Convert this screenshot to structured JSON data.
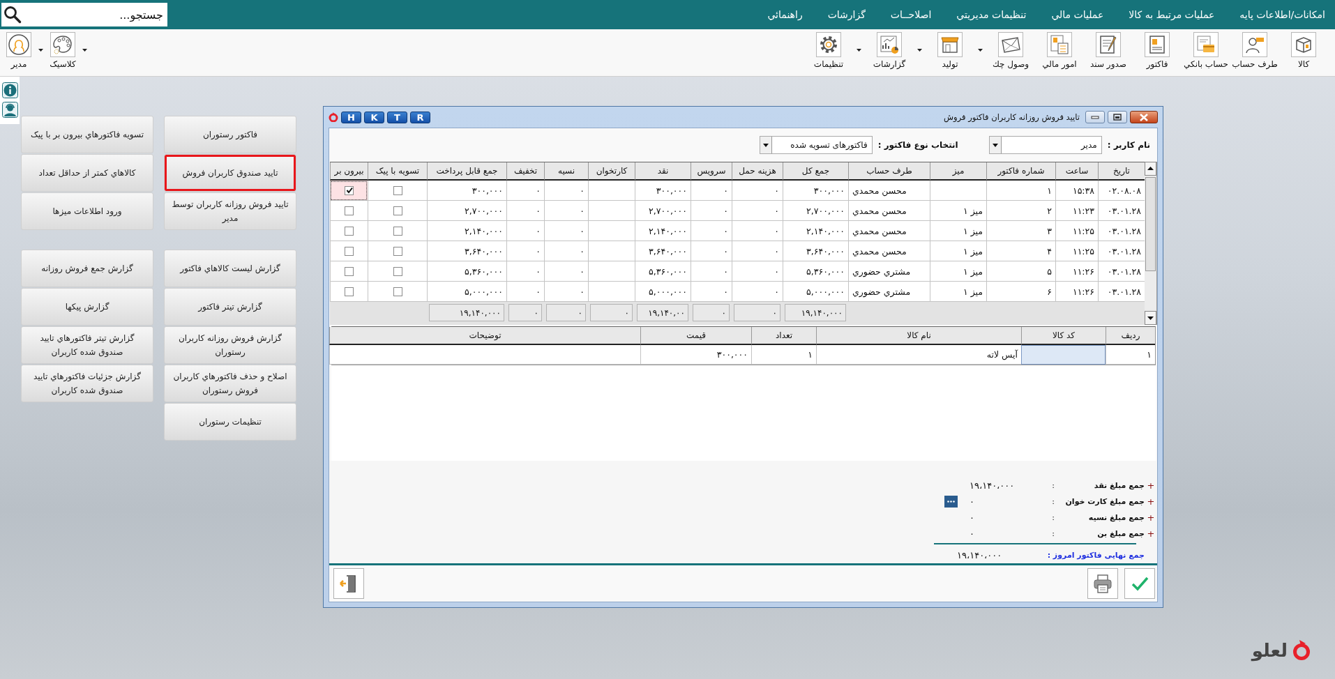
{
  "topbar": {
    "search": {
      "placeholder": "جستجو..."
    },
    "menu": [
      {
        "label": "امکانات/اطلاعات پایه"
      },
      {
        "label": "عملیات مرتبط به کالا"
      },
      {
        "label": "عملیات مالي"
      },
      {
        "label": "تنظیمات مدیریتي"
      },
      {
        "label": "اصلاحــات"
      },
      {
        "label": "گزارشات"
      },
      {
        "label": "راهنمائي"
      }
    ]
  },
  "toolbar": [
    {
      "label": "کالا",
      "dropdown": false
    },
    {
      "label": "طرف حساب",
      "dropdown": false
    },
    {
      "label": "حساب بانکي",
      "dropdown": false
    },
    {
      "label": "فاکتور",
      "dropdown": false
    },
    {
      "label": "صدور سند",
      "dropdown": false
    },
    {
      "label": "امور مالي",
      "dropdown": false
    },
    {
      "label": "وصول چك",
      "dropdown": true
    },
    {
      "label": "تولید",
      "dropdown": true
    },
    {
      "label": "گزارشات",
      "dropdown": true
    },
    {
      "label": "تنظیمات",
      "dropdown": false
    }
  ],
  "user_tools": [
    {
      "label": "کلاسیک",
      "dropdown": true
    },
    {
      "label": "مدير",
      "dropdown": true
    }
  ],
  "launcher": [
    {
      "groups": [
        [
          {
            "label": "فاکتور رستوران",
            "selected": false
          },
          {
            "label": "تایید صندوق کاربران فروش",
            "selected": true
          },
          {
            "label": "تایید فروش روزانه کاربران توسط مدیر",
            "selected": false
          }
        ],
        [
          {
            "label": "گزارش لیست کالاهاي فاکتور",
            "selected": false
          },
          {
            "label": "گزارش تیتر فاکتور",
            "selected": false
          },
          {
            "label": "گزارش فروش روزانه کاربران رستوران",
            "selected": false
          },
          {
            "label": "اصلاح و حذف فاکتورهاي کاربران فروش رستوران",
            "selected": false
          },
          {
            "label": "تنظیمات رستوران",
            "selected": false
          }
        ]
      ]
    },
    {
      "groups": [
        [
          {
            "label": "تسویه فاکتورهاي بیرون بر با پیک",
            "selected": false
          },
          {
            "label": "کالاهاي کمتر از حداقل تعداد",
            "selected": false
          },
          {
            "label": "ورود اطلاعات میزها",
            "selected": false
          }
        ],
        [
          {
            "label": "گزارش جمع فروش روزانه",
            "selected": false
          },
          {
            "label": "گزارش پیکها",
            "selected": false
          },
          {
            "label": "گزارش تیتر فاکتورهاي تایید صندوق شده کاربران",
            "selected": false
          },
          {
            "label": "گزارش جزئیات فاکتورهاي تایید صندوق شده کاربران",
            "selected": false
          }
        ]
      ]
    }
  ],
  "dialog": {
    "title": "تاييد فروش روزانه کاربران فاکتور فروش",
    "shortcut_keys": [
      "R",
      "T",
      "K",
      "H"
    ],
    "filters": [
      {
        "label": "نام کاربر :",
        "value": "مدير"
      },
      {
        "label": "انتخاب نوع فاکتور :",
        "value": "فاکتورهای تسویه شده"
      }
    ],
    "invoices": {
      "columns": [
        {
          "label": "تاریخ",
          "kind": "text"
        },
        {
          "label": "ساعت",
          "kind": "text"
        },
        {
          "label": "شماره فاکتور",
          "kind": "text"
        },
        {
          "label": "میز",
          "kind": "text"
        },
        {
          "label": "طرف حساب",
          "kind": "text"
        },
        {
          "label": "جمع کل",
          "kind": "text"
        },
        {
          "label": "هزینه حمل",
          "kind": "text"
        },
        {
          "label": "سرویس",
          "kind": "text"
        },
        {
          "label": "نقد",
          "kind": "text"
        },
        {
          "label": "کارتخوان",
          "kind": "text"
        },
        {
          "label": "نسیه",
          "kind": "text"
        },
        {
          "label": "تخفیف",
          "kind": "text"
        },
        {
          "label": "جمع قابل پرداخت",
          "kind": "text"
        },
        {
          "label": "تسویه با پیک",
          "kind": "check"
        },
        {
          "label": "بیرون بر",
          "kind": "check"
        }
      ],
      "rows": [
        {
          "selected": true,
          "date": "۰۲.۰۸.۰۸",
          "time": "۱۵:۳۸",
          "number": "۱",
          "account": "محسن محمدي",
          "total": "۳۰۰,۰۰۰",
          "delivery": "۰",
          "service": "۰",
          "cash": "۳۰۰,۰۰۰",
          "credit": "۰",
          "discount": "۰",
          "payable": "۳۰۰,۰۰۰",
          "courier_settled": false,
          "takeout": true
        },
        {
          "selected": false,
          "date": "۰۳.۰۱.۲۸",
          "time": "۱۱:۲۳",
          "number": "۲",
          "table": "میز ۱",
          "account": "محسن محمدي",
          "total": "۲,۷۰۰,۰۰۰",
          "delivery": "۰",
          "service": "۰",
          "cash": "۲,۷۰۰,۰۰۰",
          "credit": "۰",
          "discount": "۰",
          "payable": "۲,۷۰۰,۰۰۰",
          "courier_settled": false,
          "takeout": false
        },
        {
          "selected": false,
          "date": "۰۳.۰۱.۲۸",
          "time": "۱۱:۲۵",
          "number": "۳",
          "table": "میز ۱",
          "account": "محسن محمدي",
          "total": "۲,۱۴۰,۰۰۰",
          "delivery": "۰",
          "service": "۰",
          "cash": "۲,۱۴۰,۰۰۰",
          "credit": "۰",
          "discount": "۰",
          "payable": "۲,۱۴۰,۰۰۰",
          "courier_settled": false,
          "takeout": false
        },
        {
          "selected": false,
          "date": "۰۳.۰۱.۲۸",
          "time": "۱۱:۲۵",
          "number": "۴",
          "table": "میز ۱",
          "account": "محسن محمدي",
          "total": "۳,۶۴۰,۰۰۰",
          "delivery": "۰",
          "service": "۰",
          "cash": "۳,۶۴۰,۰۰۰",
          "credit": "۰",
          "discount": "۰",
          "payable": "۳,۶۴۰,۰۰۰",
          "courier_settled": false,
          "takeout": false
        },
        {
          "selected": false,
          "date": "۰۳.۰۱.۲۸",
          "time": "۱۱:۲۶",
          "number": "۵",
          "table": "میز ۱",
          "account": "مشتري حضوري",
          "total": "۵,۳۶۰,۰۰۰",
          "delivery": "۰",
          "service": "۰",
          "cash": "۵,۳۶۰,۰۰۰",
          "credit": "۰",
          "discount": "۰",
          "payable": "۵,۳۶۰,۰۰۰",
          "courier_settled": false,
          "takeout": false
        },
        {
          "selected": false,
          "date": "۰۳.۰۱.۲۸",
          "time": "۱۱:۲۶",
          "number": "۶",
          "table": "میز ۱",
          "account": "مشتري حضوري",
          "total": "۵,۰۰۰,۰۰۰",
          "delivery": "۰",
          "service": "۰",
          "cash": "۵,۰۰۰,۰۰۰",
          "credit": "۰",
          "discount": "۰",
          "payable": "۵,۰۰۰,۰۰۰",
          "courier_settled": false,
          "takeout": false
        }
      ],
      "totals": {
        "total": "۱۹,۱۴۰,۰۰۰",
        "delivery": "۰",
        "service": "۰",
        "cash": "۱۹,۱۴۰,۰۰",
        "card": "۰",
        "credit": "۰",
        "discount": "۰",
        "payable": "۱۹,۱۴۰,۰۰۰"
      }
    },
    "items": {
      "columns": [
        {
          "label": "ردیف"
        },
        {
          "label": "کد کالا"
        },
        {
          "label": "نام کالا"
        },
        {
          "label": "تعداد"
        },
        {
          "label": "قیمت"
        },
        {
          "label": "توضیحات"
        }
      ],
      "rows": [
        {
          "selected": true,
          "row_no": "۱",
          "name": "آیس لاته",
          "quantity": "۱",
          "price": "۳۰۰,۰۰۰"
        }
      ]
    },
    "summary": [
      {
        "marker": "+",
        "label": "جمع مبلغ نقد",
        "separator": ":",
        "value": "۱۹،۱۴۰،۰۰۰",
        "details_button": false
      },
      {
        "marker": "+",
        "label": "جمع مبلغ کارت خوان",
        "separator": ":",
        "value": "۰",
        "details_button": true
      },
      {
        "marker": "+",
        "label": "جمع مبلغ نسیه",
        "separator": ":",
        "value": "۰",
        "details_button": false
      },
      {
        "marker": "+",
        "label": "جمع مبلغ بن",
        "separator": ":",
        "value": "۰",
        "details_button": false
      }
    ],
    "final_total": {
      "label": "جمع نهایی فاکتور امروز :",
      "value": "۱۹،۱۴۰،۰۰۰"
    }
  },
  "brand": {
    "name": "لعلو"
  }
}
